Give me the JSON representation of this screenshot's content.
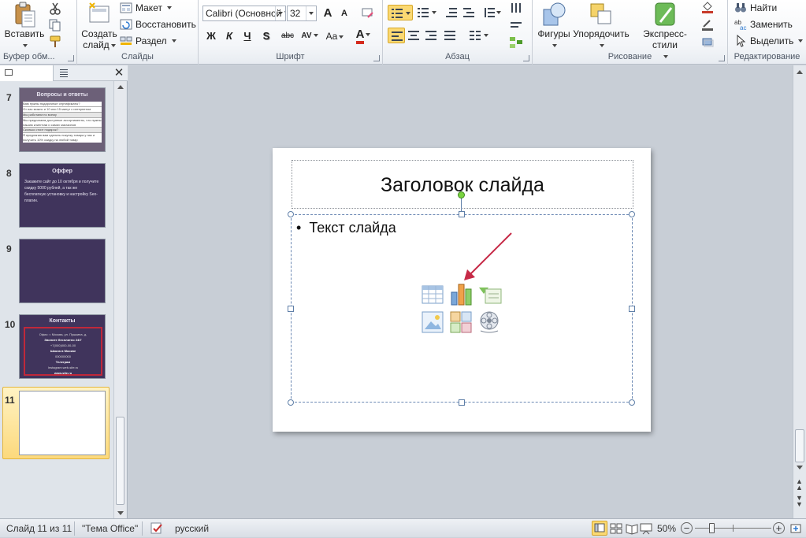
{
  "ribbon": {
    "clipboard": {
      "paste": "Вставить",
      "label": "Буфер обм..."
    },
    "slides": {
      "new_slide_line1": "Создать",
      "new_slide_line2": "слайд",
      "layout": "Макет",
      "reset": "Восстановить",
      "section": "Раздел",
      "label": "Слайды"
    },
    "font": {
      "name": "Calibri (Основной текст)",
      "size": "32",
      "bold": "Ж",
      "italic": "К",
      "underline": "Ч",
      "shadow": "S",
      "strike": "abc",
      "spacing": "AV",
      "case": "Aa",
      "color": "A",
      "grow": "A",
      "shrink": "A",
      "label": "Шрифт"
    },
    "paragraph": {
      "label": "Абзац"
    },
    "drawing": {
      "shapes": "Фигуры",
      "arrange": "Упорядочить",
      "styles": "Экспресс-стили",
      "label": "Рисование"
    },
    "editing": {
      "find": "Найти",
      "replace": "Заменить",
      "select": "Выделить",
      "label": "Редактирование"
    }
  },
  "thumbnails": [
    {
      "num": "7",
      "title": "Вопросы и ответы",
      "body": [
        "Вам нужны подарочные сертификаты?",
        "От нас можно и 10 или 15 минут с интернетом",
        "Мы работаем по всему",
        "Мы предлагаем доступные ассортименты, что нужны нашим клиентам и самих магазинов",
        "Сколько стоит подарок?",
        "Я предлагаю вам сделать покупку товара у нас и получить 10% скидку на любой товар"
      ]
    },
    {
      "num": "8",
      "title": "Оффер",
      "body": [
        "Закажите сайт до 10 октября и получите скидку 5000 рублей, а так же бесплатную установку и настройку Seo-плагин."
      ]
    },
    {
      "num": "9",
      "title": "",
      "body": []
    },
    {
      "num": "10",
      "title": "Контакты",
      "body": [
        "Офис: г. Москва, ул. Пушкина, д.",
        "Звоните бесплатно 24/7",
        "+7(000)000-00-00",
        "Школа в Москве",
        "000000000",
        "Телеграм",
        "Instagram.web-site.ru",
        "www.site.ru"
      ]
    },
    {
      "num": "11",
      "title": "",
      "body": []
    }
  ],
  "slide": {
    "title": "Заголовок слайда",
    "bullet": "Текст слайда"
  },
  "status": {
    "slide_of": "Слайд 11 из 11",
    "theme": "\"Тема Office\"",
    "language": "русский",
    "zoom": "50%"
  },
  "colors": {
    "thumb_bg": "#40345c",
    "accent_red": "#c0283a",
    "selected_thumb": "#fde59a"
  }
}
